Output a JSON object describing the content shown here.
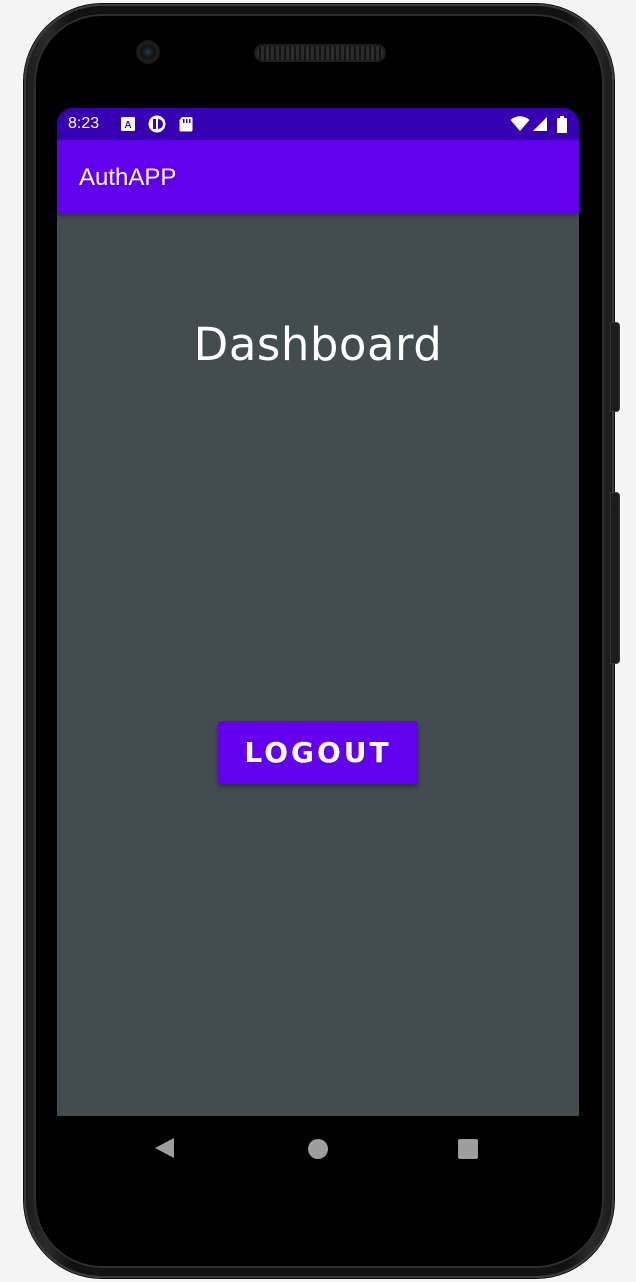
{
  "status_bar": {
    "time": "8:23",
    "icons": [
      "font-a-icon",
      "pie-icon",
      "sd-card-icon",
      "wifi-icon",
      "signal-icon",
      "battery-icon"
    ],
    "color": "#3700b3"
  },
  "app_bar": {
    "title": "AuthAPP",
    "color": "#6200ee"
  },
  "main": {
    "heading": "Dashboard",
    "logout_label": "LOGOUT",
    "background": "#434c4e"
  },
  "nav_bar": {
    "icons": [
      "back-icon",
      "home-icon",
      "recents-icon"
    ]
  }
}
